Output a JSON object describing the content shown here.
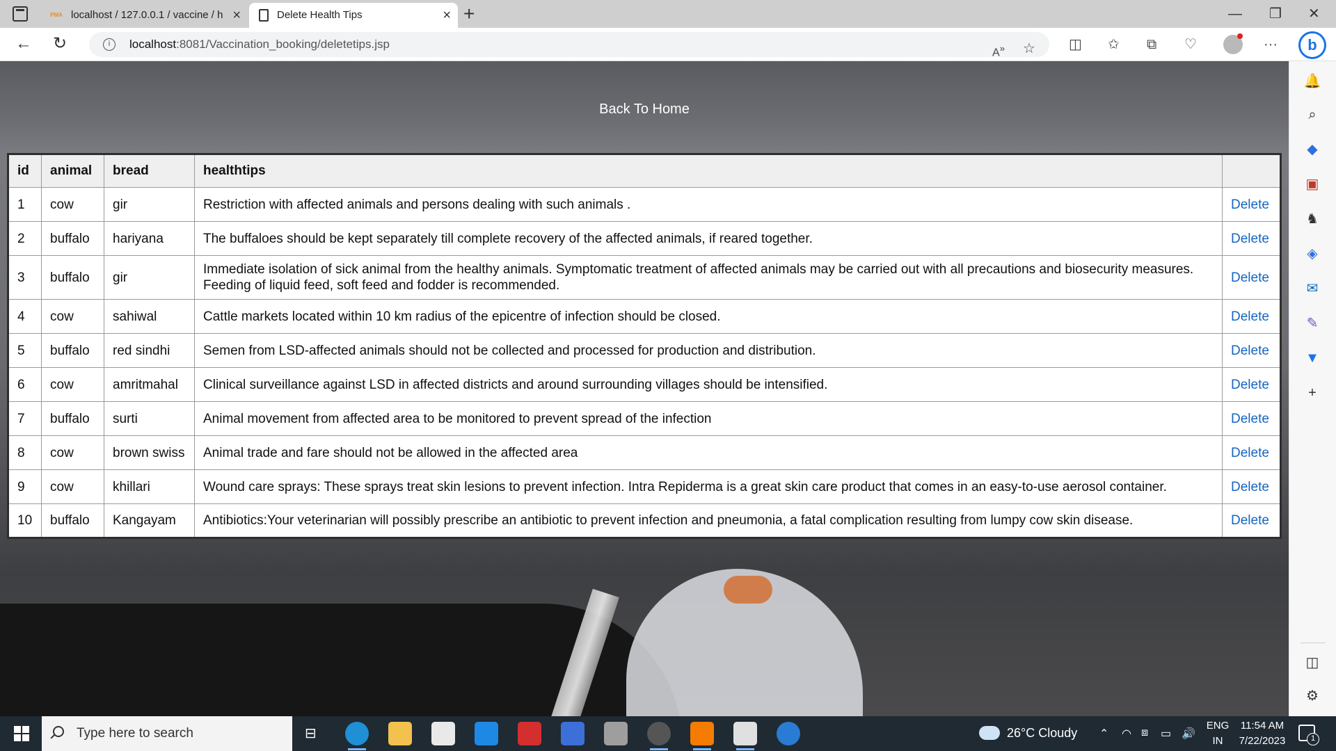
{
  "browser": {
    "tabs": [
      {
        "title": "localhost / 127.0.0.1 / vaccine / h",
        "favicon": "phpmyadmin-icon"
      },
      {
        "title": "Delete Health Tips",
        "favicon": "document-icon"
      }
    ],
    "url_host": "localhost",
    "url_path": ":8081/Vaccination_booking/deletetips.jsp"
  },
  "page": {
    "back_link": "Back To Home",
    "table": {
      "headers": [
        "id",
        "animal",
        "bread",
        "healthtips",
        ""
      ],
      "delete_label": "Delete",
      "rows": [
        {
          "id": "1",
          "animal": "cow",
          "bread": "gir",
          "tip": "Restriction with affected animals and persons dealing with such animals ."
        },
        {
          "id": "2",
          "animal": "buffalo",
          "bread": "hariyana",
          "tip": "The buffaloes should be kept separately till complete recovery of the affected animals, if reared together."
        },
        {
          "id": "3",
          "animal": "buffalo",
          "bread": "gir",
          "tip": "Immediate isolation of sick animal from the healthy animals. Symptomatic treatment of affected animals may be carried out with all precautions and biosecurity measures. Feeding of liquid feed, soft feed and fodder is recommended."
        },
        {
          "id": "4",
          "animal": "cow",
          "bread": "sahiwal",
          "tip": "Cattle markets located within 10 km radius of the epicentre of infection should be closed."
        },
        {
          "id": "5",
          "animal": "buffalo",
          "bread": "red sindhi",
          "tip": "Semen from LSD-affected animals should not be collected and processed for production and distribution."
        },
        {
          "id": "6",
          "animal": "cow",
          "bread": "amritmahal",
          "tip": "Clinical surveillance against LSD in affected districts and around surrounding villages should be intensified."
        },
        {
          "id": "7",
          "animal": "buffalo",
          "bread": "surti",
          "tip": "Animal movement from affected area to be monitored to prevent spread of the infection"
        },
        {
          "id": "8",
          "animal": "cow",
          "bread": "brown swiss",
          "tip": "Animal trade and fare should not be allowed in the affected area"
        },
        {
          "id": "9",
          "animal": "cow",
          "bread": "khillari",
          "tip": "Wound care sprays: These sprays treat skin lesions to prevent infection. Intra Repiderma is a great skin care product that comes in an easy-to-use aerosol container."
        },
        {
          "id": "10",
          "animal": "buffalo",
          "bread": "Kangayam",
          "tip": "Antibiotics:Your veterinarian will possibly prescribe an antibiotic to prevent infection and pneumonia, a fatal complication resulting from lumpy cow skin disease."
        }
      ]
    }
  },
  "taskbar": {
    "search_placeholder": "Type here to search",
    "weather": "26°C  Cloudy",
    "language": "ENG",
    "region": "IN",
    "time": "11:54 AM",
    "date": "7/22/2023",
    "notification_count": "1"
  },
  "colors": {
    "link": "#1565c0",
    "taskbar": "#1f2a33",
    "tabstrip": "#cfcfcf"
  }
}
